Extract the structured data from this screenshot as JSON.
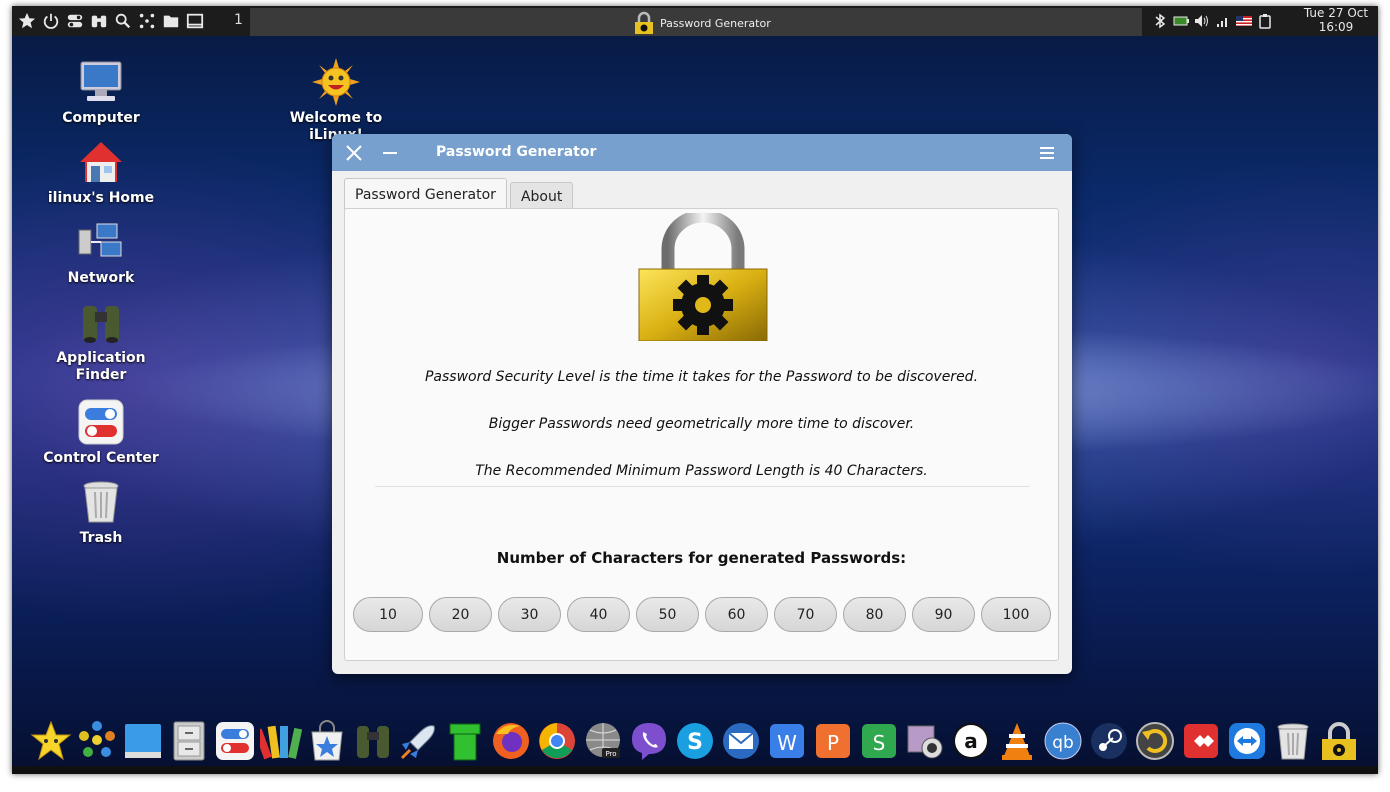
{
  "top_panel": {
    "workspace_number": "1",
    "task_title": "Password Generator",
    "clock_date": "Tue 27 Oct",
    "clock_time": "16:09",
    "left_icons": [
      "star-icon",
      "power-icon",
      "toggles-icon",
      "binoculars-icon",
      "search-icon",
      "dots-icon",
      "folder-icon",
      "window-icon"
    ],
    "tray_icons": [
      "bluetooth-icon",
      "battery-icon",
      "volume-icon",
      "signal-icon",
      "flag-icon",
      "clipboard-icon"
    ]
  },
  "desktop_icons": [
    {
      "label": "Computer",
      "icon": "computer-icon"
    },
    {
      "label": "ilinux's Home",
      "icon": "home-icon"
    },
    {
      "label": "Network",
      "icon": "network-icon"
    },
    {
      "label": "Application\nFinder",
      "icon": "binoculars-icon"
    },
    {
      "label": "Control Center",
      "icon": "control-center-icon"
    },
    {
      "label": "Trash",
      "icon": "trash-icon"
    },
    {
      "label": "Welcome to\niLinux!",
      "icon": "sun-face-icon"
    }
  ],
  "window": {
    "title": "Password Generator",
    "tabs": [
      {
        "label": "Password Generator",
        "active": true
      },
      {
        "label": "About",
        "active": false
      }
    ],
    "info_lines": [
      "Password Security Level is the time it takes for the Password to be discovered.",
      "Bigger Passwords need geometrically more time to discover.",
      "The Recommended Minimum Password Length is 40 Characters."
    ],
    "count_label": "Number of Characters for generated Passwords:",
    "length_options": [
      "10",
      "20",
      "30",
      "40",
      "50",
      "60",
      "70",
      "80",
      "90",
      "100"
    ]
  },
  "dock": [
    "star-icon",
    "app-grid-icon",
    "desktop-icon",
    "file-cabinet-icon",
    "control-center-icon",
    "color-palette-icon",
    "software-store-icon",
    "binoculars-icon",
    "rocket-icon",
    "green-pipe-icon",
    "firefox-icon",
    "chrome-icon",
    "globe-pro-icon",
    "viber-icon",
    "skype-icon",
    "mail-icon",
    "writer-icon",
    "presentation-icon",
    "spreadsheet-icon",
    "webcam-icon",
    "amazon-icon",
    "vlc-icon",
    "qbittorrent-icon",
    "steam-icon",
    "timeshift-icon",
    "anydesk-icon",
    "teamviewer-icon",
    "trash-icon",
    "password-lock-icon"
  ]
}
